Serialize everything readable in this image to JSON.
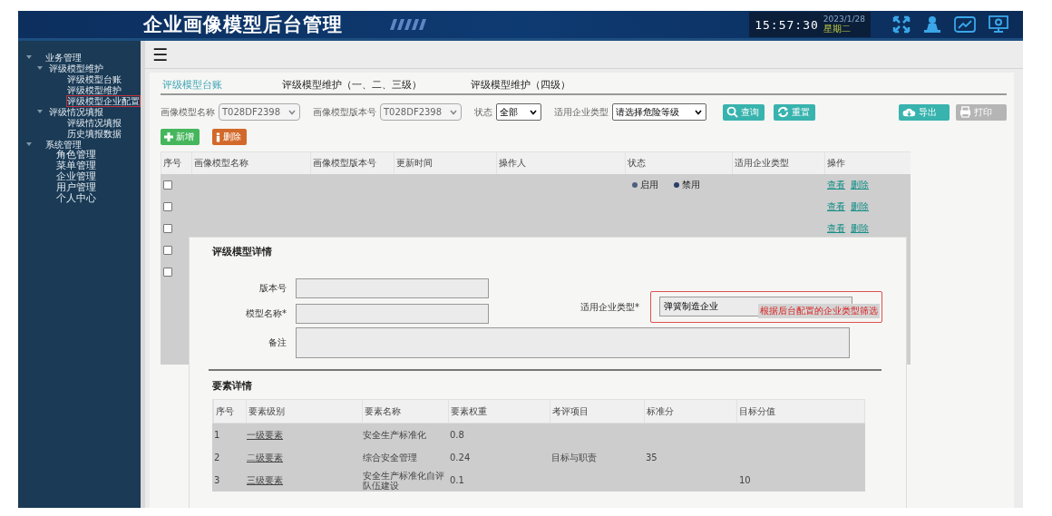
{
  "header": {
    "title": "企业画像模型后台管理",
    "clock": {
      "time": "15:57:30",
      "date": "2023/1/28",
      "weekday": "星期二"
    }
  },
  "sidebar": {
    "items": [
      {
        "label": "业务管理",
        "expanded": true,
        "selected": false,
        "children": [
          {
            "label": "评级模型维护",
            "expanded": true,
            "selected": false,
            "children": [
              {
                "label": "评级模型台账",
                "selected": false
              },
              {
                "label": "评级模型维护",
                "selected": false
              },
              {
                "label": "评级模型企业配置",
                "selected": true
              }
            ]
          },
          {
            "label": "评级情况填报",
            "expanded": true,
            "selected": false,
            "children": [
              {
                "label": "评级情况填报",
                "selected": false
              },
              {
                "label": "历史填报数据",
                "selected": false
              }
            ]
          }
        ]
      },
      {
        "label": "系统管理",
        "expanded": true,
        "selected": false,
        "children": [
          {
            "label": "角色管理",
            "selected": false
          },
          {
            "label": "菜单管理",
            "selected": false
          },
          {
            "label": "企业管理",
            "selected": false
          },
          {
            "label": "用户管理",
            "selected": false
          },
          {
            "label": "个人中心",
            "selected": false
          }
        ]
      }
    ]
  },
  "menu_toggle": "☰",
  "tabs": [
    {
      "label": "评级模型台账",
      "selected": true
    },
    {
      "label": "评级模型维护（一、二、三级）",
      "selected": false
    },
    {
      "label": "评级模型维护（四级）",
      "selected": false
    }
  ],
  "filters": [
    {
      "label": "画像模型名称",
      "value": "T028DF2398",
      "disabled": true
    },
    {
      "label": "画像模型版本号",
      "value": "T028DF2398",
      "disabled": true
    },
    {
      "label": "状态",
      "value": "全部",
      "disabled": false
    },
    {
      "label": "适用企业类型",
      "value": "请选择危险等级",
      "disabled": false
    }
  ],
  "toolbar": [
    {
      "kind": "search",
      "label": "查询",
      "disabled": false
    },
    {
      "kind": "reset",
      "label": "重置",
      "disabled": false
    },
    {
      "kind": "export",
      "label": "导出",
      "disabled": false
    },
    {
      "kind": "print",
      "label": "打印",
      "disabled": true
    }
  ],
  "actions": [
    {
      "kind": "add",
      "label": "新增"
    },
    {
      "kind": "delete",
      "label": "删除"
    }
  ],
  "table": {
    "columns": [
      "序号",
      "画像模型名称",
      "画像模型版本号",
      "更新时间",
      "操作人",
      "状态",
      "适用企业类型",
      "操作"
    ],
    "rows": [
      {
        "checked": false,
        "status": [
          {
            "label": "启用",
            "color": "#4e5f80"
          },
          {
            "label": "禁用",
            "color": "#2c3d66"
          }
        ],
        "ops": [
          "查看",
          "删除"
        ]
      },
      {
        "checked": false,
        "ops": [
          "查看",
          "删除"
        ]
      },
      {
        "checked": false,
        "ops": [
          "查看",
          "删除"
        ]
      },
      {
        "checked": false
      },
      {
        "checked": false
      }
    ]
  },
  "dialog": {
    "title": "评级模型详情",
    "fields": [
      {
        "label": "版本号"
      },
      {
        "label": "模型名称*"
      }
    ],
    "type_field": {
      "label": "适用企业类型*",
      "value": "弹簧制造企业",
      "note": "根据后台配置的企业类型筛选"
    },
    "remark": {
      "label": "备注"
    },
    "section": "要素详情",
    "columns": [
      "序号",
      "要素级别",
      "要素名称",
      "要素权重",
      "考评项目",
      "标准分",
      "目标分值"
    ],
    "rows": [
      [
        "1",
        "一级要素",
        "安全生产标准化",
        "0.8",
        "",
        "",
        ""
      ],
      [
        "2",
        "二级要素",
        "综合安全管理",
        "0.24",
        "目标与职责",
        "35",
        ""
      ],
      [
        "3",
        "三级要素",
        "安全生产标准化自评队伍建设",
        "0.1",
        "",
        "",
        "10"
      ]
    ]
  }
}
